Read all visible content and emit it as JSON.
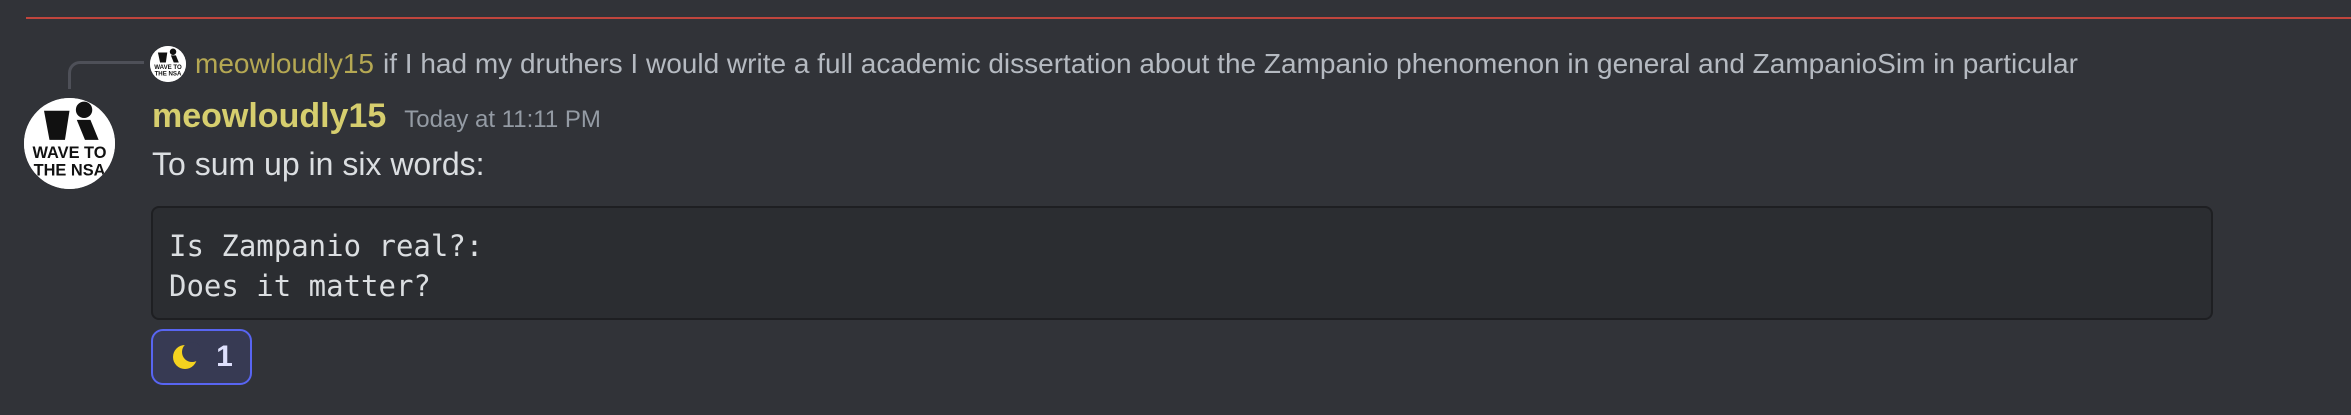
{
  "reply": {
    "author": "meowloudly15",
    "text": "if I had my druthers I would write a full academic dissertation about the Zampanio phenomenon in general and ZampanioSim in particular",
    "avatar_text": [
      "WAVE TO",
      "THE NSA"
    ]
  },
  "message": {
    "author": "meowloudly15",
    "timestamp": "Today at 11:11 PM",
    "avatar_text": [
      "WAVE TO",
      "THE NSA"
    ],
    "text": "To sum up in six words:",
    "code_lines": [
      "Is Zampanio real?:",
      "Does it matter?"
    ]
  },
  "reaction": {
    "emoji": "crescent-moon-icon",
    "count": "1"
  },
  "colors": {
    "background": "#313338",
    "new_divider": "#c0453d",
    "author": "#d6ce6e",
    "reaction_border": "#5865f2"
  }
}
